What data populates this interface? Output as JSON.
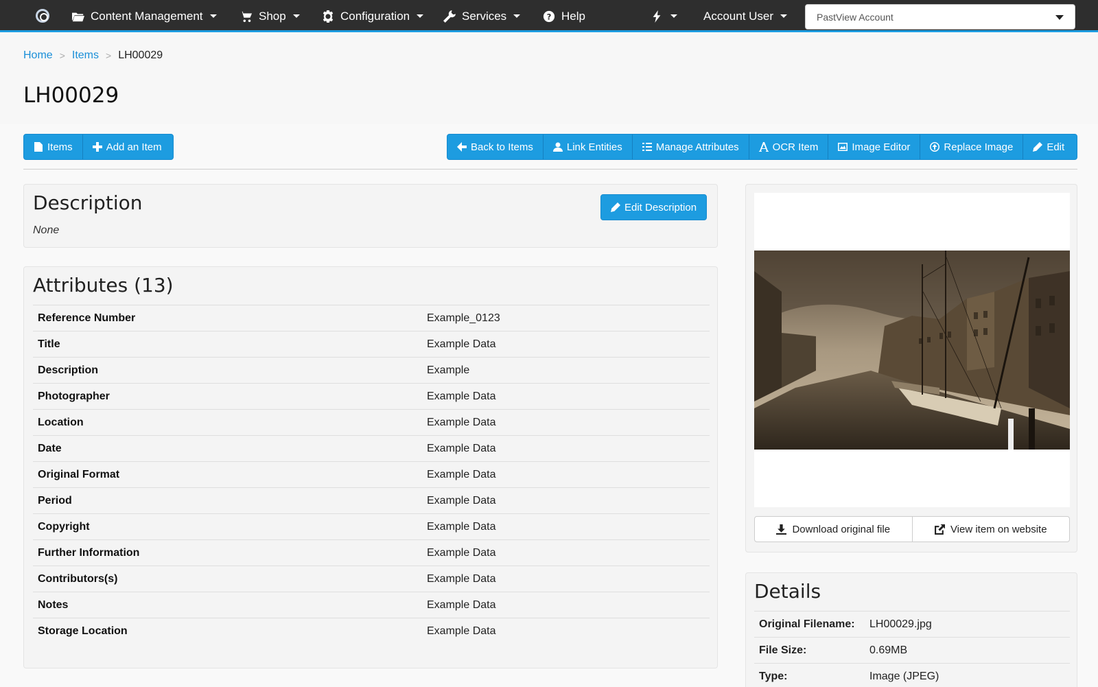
{
  "navbar": {
    "logo_icon": "pastview-logo-icon",
    "items": [
      {
        "label": "Content Management",
        "icon": "folder-open-icon"
      },
      {
        "label": "Shop",
        "icon": "cart-icon"
      },
      {
        "label": "Configuration",
        "icon": "gear-icon"
      },
      {
        "label": "Services",
        "icon": "wrench-icon"
      },
      {
        "label": "Help",
        "icon": "question-circle-icon"
      }
    ],
    "quick_icon": "bolt-icon",
    "account_user": "Account User",
    "account_select": "PastView Account"
  },
  "breadcrumb": {
    "home": "Home",
    "items": "Items",
    "current": "LH00029"
  },
  "page_title": "LH00029",
  "toolbar": {
    "left": [
      {
        "label": "Items",
        "icon": "file-icon"
      },
      {
        "label": "Add an Item",
        "icon": "plus-icon"
      }
    ],
    "right": [
      {
        "label": "Back to Items",
        "icon": "arrow-left-icon"
      },
      {
        "label": "Link Entities",
        "icon": "user-icon"
      },
      {
        "label": "Manage Attributes",
        "icon": "list-icon"
      },
      {
        "label": "OCR Item",
        "icon": "font-icon"
      },
      {
        "label": "Image Editor",
        "icon": "picture-icon"
      },
      {
        "label": "Replace Image",
        "icon": "upload-circle-icon"
      },
      {
        "label": "Edit",
        "icon": "pencil-icon"
      }
    ]
  },
  "description": {
    "title": "Description",
    "value": "None",
    "edit_button": "Edit Description"
  },
  "attributes": {
    "title": "Attributes (13)",
    "rows": [
      {
        "key": "Reference Number",
        "value": "Example_0123"
      },
      {
        "key": "Title",
        "value": "Example Data"
      },
      {
        "key": "Description",
        "value": "Example"
      },
      {
        "key": "Photographer",
        "value": "Example Data"
      },
      {
        "key": "Location",
        "value": "Example Data"
      },
      {
        "key": "Date",
        "value": "Example Data"
      },
      {
        "key": "Original Format",
        "value": "Example Data"
      },
      {
        "key": "Period",
        "value": "Example Data"
      },
      {
        "key": "Copyright",
        "value": "Example Data"
      },
      {
        "key": "Further Information",
        "value": "Example Data"
      },
      {
        "key": "Contributors(s)",
        "value": "Example Data"
      },
      {
        "key": "Notes",
        "value": "Example Data"
      },
      {
        "key": "Storage Location",
        "value": "Example Data"
      }
    ]
  },
  "image_panel": {
    "download_button": "Download original file",
    "view_button": "View item on website"
  },
  "details": {
    "title": "Details",
    "rows": [
      {
        "key": "Original Filename:",
        "value": "LH00029.jpg"
      },
      {
        "key": "File Size:",
        "value": "0.69MB"
      },
      {
        "key": "Type:",
        "value": "Image (JPEG)"
      }
    ]
  },
  "colors": {
    "navbar_bg": "#2e2e2e",
    "accent": "#1d9ce0",
    "link": "#1a8fd8",
    "sepia": "#6b5a44"
  }
}
